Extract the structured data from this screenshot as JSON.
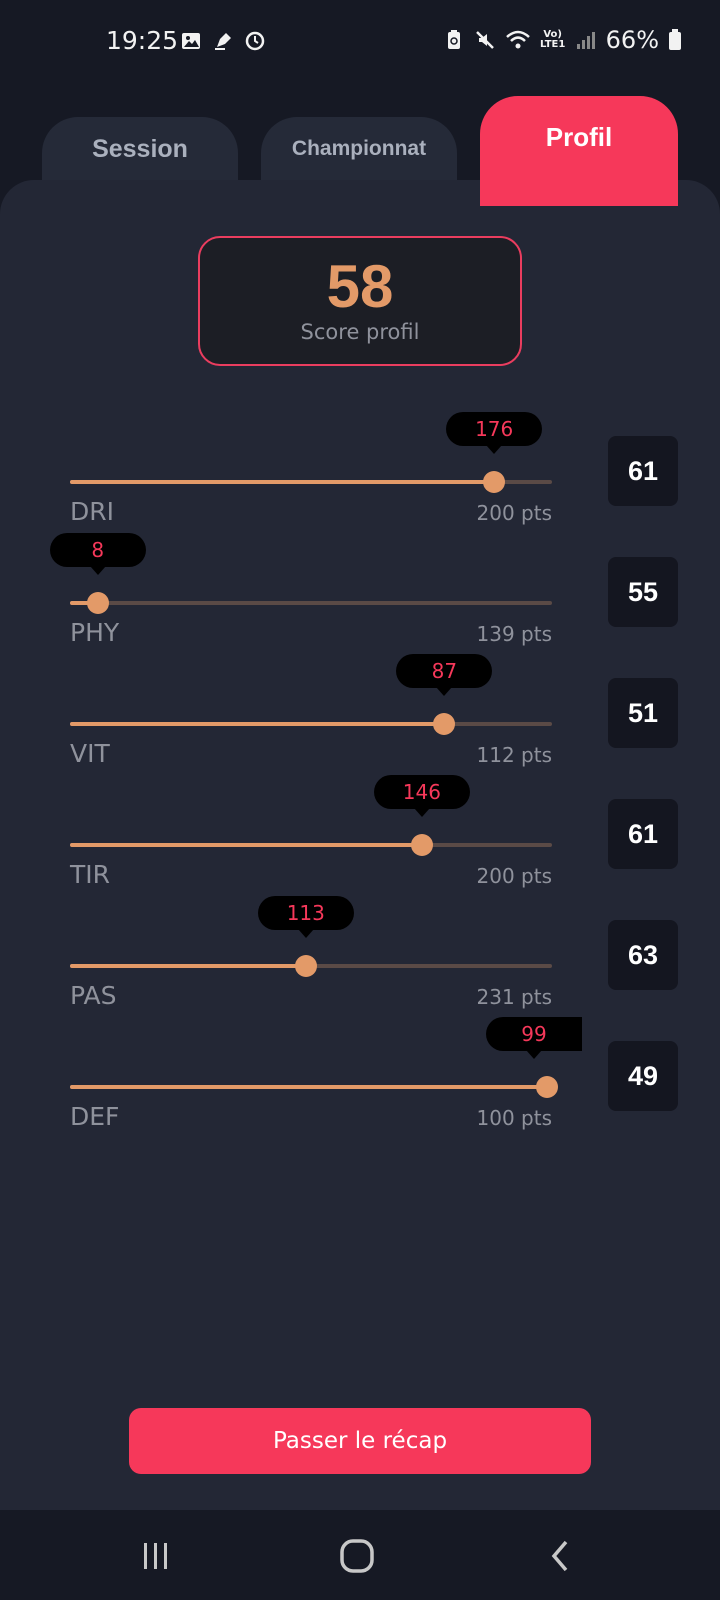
{
  "status_bar": {
    "time": "19:25",
    "battery": "66%",
    "network_label": "Vo) LTE1",
    "left_icons": [
      "gallery-icon",
      "pen-icon",
      "clock-icon"
    ],
    "right_icons": [
      "recycle-battery-icon",
      "mute-icon",
      "wifi-icon",
      "volte-icon",
      "signal-icon",
      "battery-icon"
    ]
  },
  "tabs": [
    {
      "label": "Session",
      "active": false
    },
    {
      "label": "Championnat",
      "active": false
    },
    {
      "label": "Profil",
      "active": true
    }
  ],
  "score": {
    "value": "58",
    "label": "Score profil"
  },
  "stats": [
    {
      "label": "DRI",
      "current": "176",
      "max_label": "200 pts",
      "max": 200,
      "score": "61"
    },
    {
      "label": "PHY",
      "current": "8",
      "max_label": "139 pts",
      "max": 139,
      "score": "55"
    },
    {
      "label": "VIT",
      "current": "87",
      "max_label": "112 pts",
      "max": 112,
      "score": "51"
    },
    {
      "label": "TIR",
      "current": "146",
      "max_label": "200 pts",
      "max": 200,
      "score": "61"
    },
    {
      "label": "PAS",
      "current": "113",
      "max_label": "231 pts",
      "max": 231,
      "score": "63"
    },
    {
      "label": "DEF",
      "current": "99",
      "max_label": "100 pts",
      "max": 100,
      "score": "49"
    }
  ],
  "cta": {
    "label": "Passer le récap"
  },
  "colors": {
    "accent": "#f6385a",
    "slider": "#e39a68",
    "panel": "#232735",
    "background": "#161924"
  },
  "navbar": {
    "items": [
      "recent-apps-icon",
      "home-icon",
      "back-icon"
    ]
  }
}
